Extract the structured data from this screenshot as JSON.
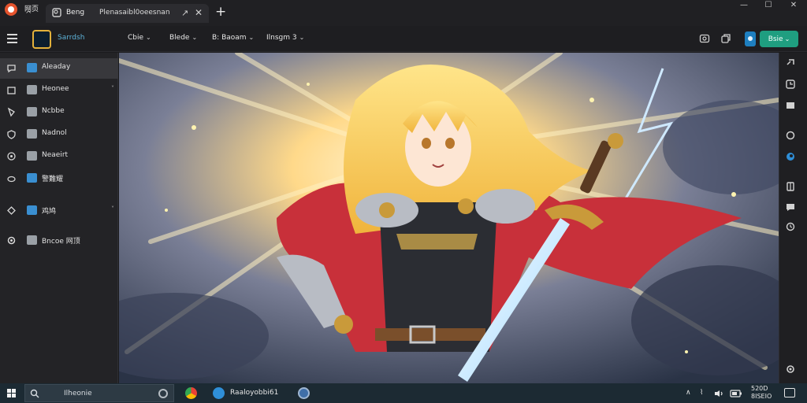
{
  "window": {
    "app_name": "网页",
    "tab_title": "Beng",
    "tab_url": "Plenasaibl0oeesnan",
    "controls": [
      "—",
      "☐",
      "✕"
    ]
  },
  "toolbar": {
    "brand": "Sarrdsh",
    "menus": [
      {
        "label": "Cbie"
      },
      {
        "label": "Blede"
      },
      {
        "label": "B: Baoam"
      },
      {
        "label": "Ilnsgm 3"
      }
    ],
    "cta_label": "Bsie"
  },
  "sidebar": {
    "items": [
      {
        "label": "Aleaday",
        "icon": "chat-icon",
        "color": "#3a8fd1",
        "active": true,
        "chevron": false
      },
      {
        "label": "Heonee",
        "icon": "square-icon",
        "color": "#9aa0a6",
        "active": false,
        "chevron": true
      },
      {
        "label": "Ncbbe",
        "icon": "pin-icon",
        "color": "#9aa0a6",
        "active": false,
        "chevron": false
      },
      {
        "label": "Nadnol",
        "icon": "shield-icon",
        "color": "#9aa0a6",
        "active": false,
        "chevron": false
      },
      {
        "label": "Neaeirt",
        "icon": "target-icon",
        "color": "#9aa0a6",
        "active": false,
        "chevron": false
      },
      {
        "label": "警難耀",
        "icon": "cloud-icon",
        "color": "#3a8fd1",
        "active": false,
        "chevron": false
      },
      {
        "label": "鸡鸠",
        "icon": "tag-icon",
        "color": "#3a8fd1",
        "active": false,
        "chevron": true
      },
      {
        "label": "Bncoe 网顶",
        "icon": "settings-icon",
        "color": "#9aa0a6",
        "active": false,
        "chevron": false
      }
    ]
  },
  "taskbar": {
    "search_text": "Ilheonie",
    "app_label": "Raaloyobbi61",
    "clock_line1": "520D",
    "clock_line2": "8ISEIO"
  },
  "colors": {
    "accent": "#1f9e80",
    "brand": "#e3b13b",
    "link": "#3a8fd1"
  }
}
